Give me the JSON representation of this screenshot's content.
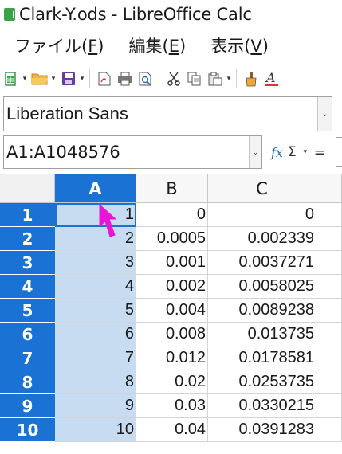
{
  "window": {
    "title": "Clark-Y.ods - LibreOffice Calc"
  },
  "menubar": {
    "items": [
      {
        "label": "ファイル(",
        "key": "F",
        "end": ")"
      },
      {
        "label": "編集(",
        "key": "E",
        "end": ")"
      },
      {
        "label": "表示(",
        "key": "V",
        "end": ")"
      }
    ]
  },
  "toolbar": {
    "buttons": [
      "new-icon",
      "open-icon",
      "save-icon",
      "export-pdf-icon",
      "print-icon",
      "print-preview-icon",
      "cut-icon",
      "copy-icon",
      "paste-icon",
      "clone-formatting-icon",
      "font-color-icon"
    ]
  },
  "font_name": {
    "value": "Liberation Sans"
  },
  "formula_bar": {
    "name_box": "A1:A1048576",
    "fx": "fx",
    "sigma": "Σ",
    "equals": "="
  },
  "sheet": {
    "columns": [
      "A",
      "B",
      "C"
    ],
    "selected_column": "A",
    "rows": [
      {
        "n": "1",
        "a": "1",
        "b": "0",
        "c": "0"
      },
      {
        "n": "2",
        "a": "2",
        "b": "0.0005",
        "c": "0.002339"
      },
      {
        "n": "3",
        "a": "3",
        "b": "0.001",
        "c": "0.0037271"
      },
      {
        "n": "4",
        "a": "4",
        "b": "0.002",
        "c": "0.0058025"
      },
      {
        "n": "5",
        "a": "5",
        "b": "0.004",
        "c": "0.0089238"
      },
      {
        "n": "6",
        "a": "6",
        "b": "0.008",
        "c": "0.013735"
      },
      {
        "n": "7",
        "a": "7",
        "b": "0.012",
        "c": "0.0178581"
      },
      {
        "n": "8",
        "a": "8",
        "b": "0.02",
        "c": "0.0253735"
      },
      {
        "n": "9",
        "a": "9",
        "b": "0.03",
        "c": "0.0330215"
      },
      {
        "n": "10",
        "a": "10",
        "b": "0.04",
        "c": "0.0391283"
      }
    ]
  },
  "colors": {
    "selection": "#1a73d4",
    "selected_fill": "#c7dcf1",
    "cursor": "#e815d6"
  }
}
